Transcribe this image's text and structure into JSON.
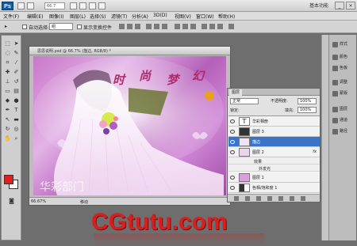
{
  "titlebar": {
    "app_logo": "Ps",
    "zoom_value": "66.7",
    "workspace_label": "基本功能",
    "min": "_",
    "max": "□",
    "close": "×"
  },
  "menu": [
    "文件(F)",
    "编辑(E)",
    "图像(I)",
    "图层(L)",
    "选择(S)",
    "滤镜(T)",
    "分析(A)",
    "3D(D)",
    "视图(V)",
    "窗口(W)",
    "帮助(H)"
  ],
  "options": {
    "auto_select_label": "自动选择:",
    "auto_select_value": "组",
    "show_transform_label": "显示变换控件"
  },
  "document": {
    "title": "思思说明.psd @ 66.7% (描边, RGB/8) *",
    "status_zoom": "66.67%",
    "status_mode": "移动"
  },
  "artwork": {
    "title_chars": [
      "时",
      "尚",
      "梦",
      "幻"
    ],
    "corner_text": "华彩部门"
  },
  "layers_panel": {
    "tab": "图层",
    "blend_mode": "正常",
    "opacity_label": "不透明度:",
    "opacity_value": "100%",
    "lock_label": "锁定:",
    "fill_label": "填充:",
    "fill_value": "100%",
    "layers": [
      {
        "name": "华彩相册",
        "type": "text",
        "selected": false,
        "fx": ""
      },
      {
        "name": "图层 3",
        "type": "mask",
        "selected": false,
        "fx": ""
      },
      {
        "name": "描边",
        "type": "normal",
        "selected": true,
        "fx": ""
      },
      {
        "name": "图层 2",
        "type": "normal",
        "selected": false,
        "fx": "fx"
      },
      {
        "name": "图层 1",
        "type": "normal",
        "selected": false,
        "fx": ""
      },
      {
        "name": "色相/饱和度 1",
        "type": "adjust",
        "selected": false,
        "fx": ""
      }
    ],
    "effects_label": "效果",
    "outer_glow_label": "外发光"
  },
  "dock": [
    "样式",
    "颜色",
    "色板",
    "调整",
    "蒙版",
    "图层",
    "通道",
    "路径"
  ],
  "watermark": "CGtutu.com",
  "colors": {
    "foreground": "#e0201c",
    "background": "#ffffff",
    "selection": "#3a74c9",
    "watermark": "#d61f1f"
  }
}
